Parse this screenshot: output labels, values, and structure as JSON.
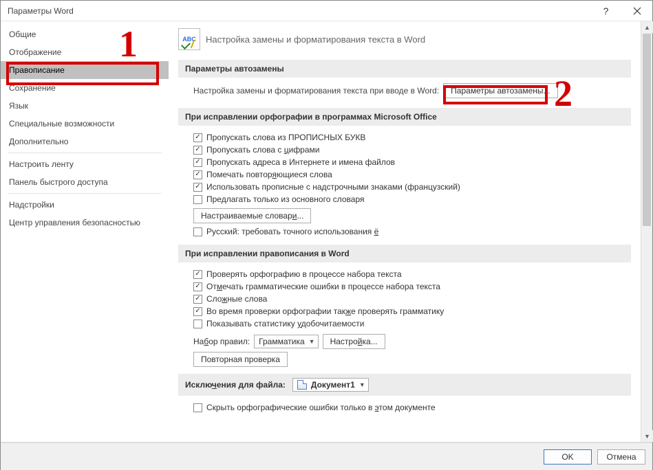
{
  "window": {
    "title": "Параметры Word"
  },
  "sidebar": {
    "items": [
      "Общие",
      "Отображение",
      "Правописание",
      "Сохранение",
      "Язык",
      "Специальные возможности",
      "Дополнительно"
    ],
    "items2": [
      "Настроить ленту",
      "Панель быстрого доступа"
    ],
    "items3": [
      "Надстройки",
      "Центр управления безопасностью"
    ],
    "selected_index": 2
  },
  "heading": {
    "text": "Настройка замены и форматирования текста в Word"
  },
  "autocorrect": {
    "section": "Параметры автозамены",
    "desc": "Настройка замены и форматирования текста при вводе в Word:",
    "button": "Параметры автозамены..."
  },
  "spelling_office": {
    "section": "При исправлении орфографии в программах Microsoft Office",
    "opts": [
      "Пропускать слова из ПРОПИСНЫХ БУКВ",
      "Пропускать слова с цифрами",
      "Пропускать адреса в Интернете и имена файлов",
      "Помечать повторяющиеся слова",
      "Использовать прописные с надстрочными знаками (французский)",
      "Предлагать только из основного словаря"
    ],
    "checked": [
      true,
      true,
      true,
      true,
      true,
      false
    ],
    "dict_btn": "Настраиваемые словари...",
    "rus_e": "Русский: требовать точного использования ё"
  },
  "spelling_word": {
    "section": "При исправлении правописания в Word",
    "opts": [
      "Проверять орфографию в процессе набора текста",
      "Отмечать грамматические ошибки в процессе набора текста",
      "Сложные слова",
      "Во время проверки орфографии также проверять грамматику",
      "Показывать статистику удобочитаемости"
    ],
    "checked": [
      true,
      true,
      true,
      true,
      false
    ],
    "rules_label": "Набор правил:",
    "rules_value": "Грамматика",
    "settings_btn": "Настройка...",
    "recheck_btn": "Повторная проверка"
  },
  "exceptions": {
    "section": "Исключения для файла:",
    "file": "Документ1",
    "hide_spelling": "Скрыть орфографические ошибки только в этом документе"
  },
  "footer": {
    "ok": "OK",
    "cancel": "Отмена"
  },
  "annot": {
    "n1": "1",
    "n2": "2"
  }
}
